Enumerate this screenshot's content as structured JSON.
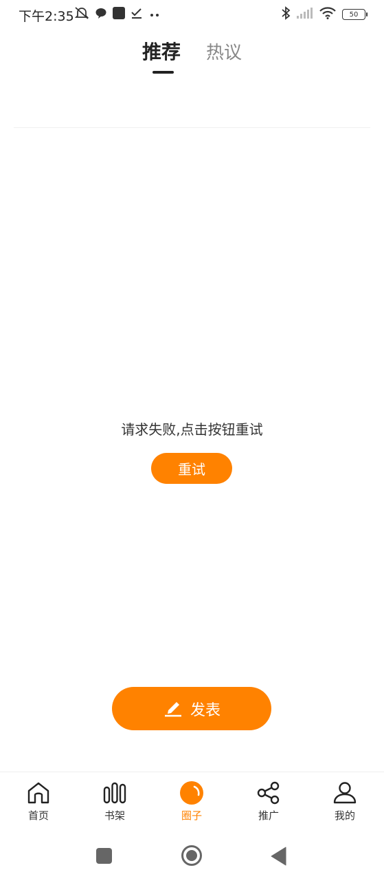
{
  "status_bar": {
    "time": "下午2:35",
    "battery": "50"
  },
  "top_tabs": [
    {
      "label": "推荐",
      "active": true
    },
    {
      "label": "热议",
      "active": false
    }
  ],
  "error": {
    "message": "请求失败,点击按钮重试",
    "retry_label": "重试"
  },
  "publish": {
    "label": "发表",
    "icon": "pencil-icon"
  },
  "bottom_nav": [
    {
      "label": "首页",
      "icon": "home-icon",
      "active": false
    },
    {
      "label": "书架",
      "icon": "bookshelf-icon",
      "active": false
    },
    {
      "label": "圈子",
      "icon": "circle-icon",
      "active": true
    },
    {
      "label": "推广",
      "icon": "share-icon",
      "active": false
    },
    {
      "label": "我的",
      "icon": "user-icon",
      "active": false
    }
  ],
  "colors": {
    "accent": "#ff8200",
    "text": "#222222",
    "inactive_tab": "#888888"
  }
}
